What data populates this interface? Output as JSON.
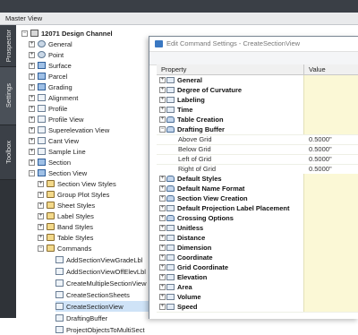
{
  "panel": {
    "title": "Master View"
  },
  "side_tabs": [
    {
      "label": "Prospector",
      "active": false
    },
    {
      "label": "Settings",
      "active": true
    },
    {
      "label": "Toolbox",
      "active": false
    }
  ],
  "tree": {
    "root": "12071 Design Channel",
    "items": [
      {
        "label": "General"
      },
      {
        "label": "Point"
      },
      {
        "label": "Surface"
      },
      {
        "label": "Parcel"
      },
      {
        "label": "Grading"
      },
      {
        "label": "Alignment"
      },
      {
        "label": "Profile"
      },
      {
        "label": "Profile View"
      },
      {
        "label": "Superelevation View"
      },
      {
        "label": "Cant View"
      },
      {
        "label": "Sample Line"
      },
      {
        "label": "Section"
      },
      {
        "label": "Section View"
      },
      {
        "label": "Section View Styles"
      },
      {
        "label": "Group Plot Styles"
      },
      {
        "label": "Sheet Styles"
      },
      {
        "label": "Label Styles"
      },
      {
        "label": "Band Styles"
      },
      {
        "label": "Table Styles"
      },
      {
        "label": "Commands"
      },
      {
        "label": "AddSectionViewGradeLbl"
      },
      {
        "label": "AddSectionViewOffElevLbl"
      },
      {
        "label": "CreateMultipleSectionView"
      },
      {
        "label": "CreateSectionSheets"
      },
      {
        "label": "CreateSectionView"
      },
      {
        "label": "DraftingBuffer"
      },
      {
        "label": "ProjectObjectsToMultiSect"
      }
    ]
  },
  "dialog": {
    "title": "Edit Command Settings - CreateSectionView",
    "col_property": "Property",
    "col_value": "Value",
    "rows": [
      {
        "name": "General",
        "kind": "cat"
      },
      {
        "name": "Degree of Curvature",
        "kind": "cat"
      },
      {
        "name": "Labeling",
        "kind": "cat"
      },
      {
        "name": "Time",
        "kind": "cat"
      },
      {
        "name": "Table Creation",
        "kind": "cat"
      },
      {
        "name": "Drafting Buffer",
        "kind": "cat",
        "expanded": true
      },
      {
        "name": "Above Grid",
        "kind": "sub",
        "value": "0.5000\""
      },
      {
        "name": "Below Grid",
        "kind": "sub",
        "value": "0.5000\""
      },
      {
        "name": "Left of Grid",
        "kind": "sub",
        "value": "0.5000\""
      },
      {
        "name": "Right of Grid",
        "kind": "sub",
        "value": "0.5000\""
      },
      {
        "name": "Default Styles",
        "kind": "cat"
      },
      {
        "name": "Default Name Format",
        "kind": "cat"
      },
      {
        "name": "Section View Creation",
        "kind": "cat"
      },
      {
        "name": "Default Projection Label Placement",
        "kind": "cat"
      },
      {
        "name": "Crossing Options",
        "kind": "cat"
      },
      {
        "name": "Unitless",
        "kind": "cat"
      },
      {
        "name": "Distance",
        "kind": "cat"
      },
      {
        "name": "Dimension",
        "kind": "cat"
      },
      {
        "name": "Coordinate",
        "kind": "cat"
      },
      {
        "name": "Grid Coordinate",
        "kind": "cat"
      },
      {
        "name": "Elevation",
        "kind": "cat"
      },
      {
        "name": "Area",
        "kind": "cat"
      },
      {
        "name": "Volume",
        "kind": "cat"
      },
      {
        "name": "Speed",
        "kind": "cat"
      }
    ]
  }
}
